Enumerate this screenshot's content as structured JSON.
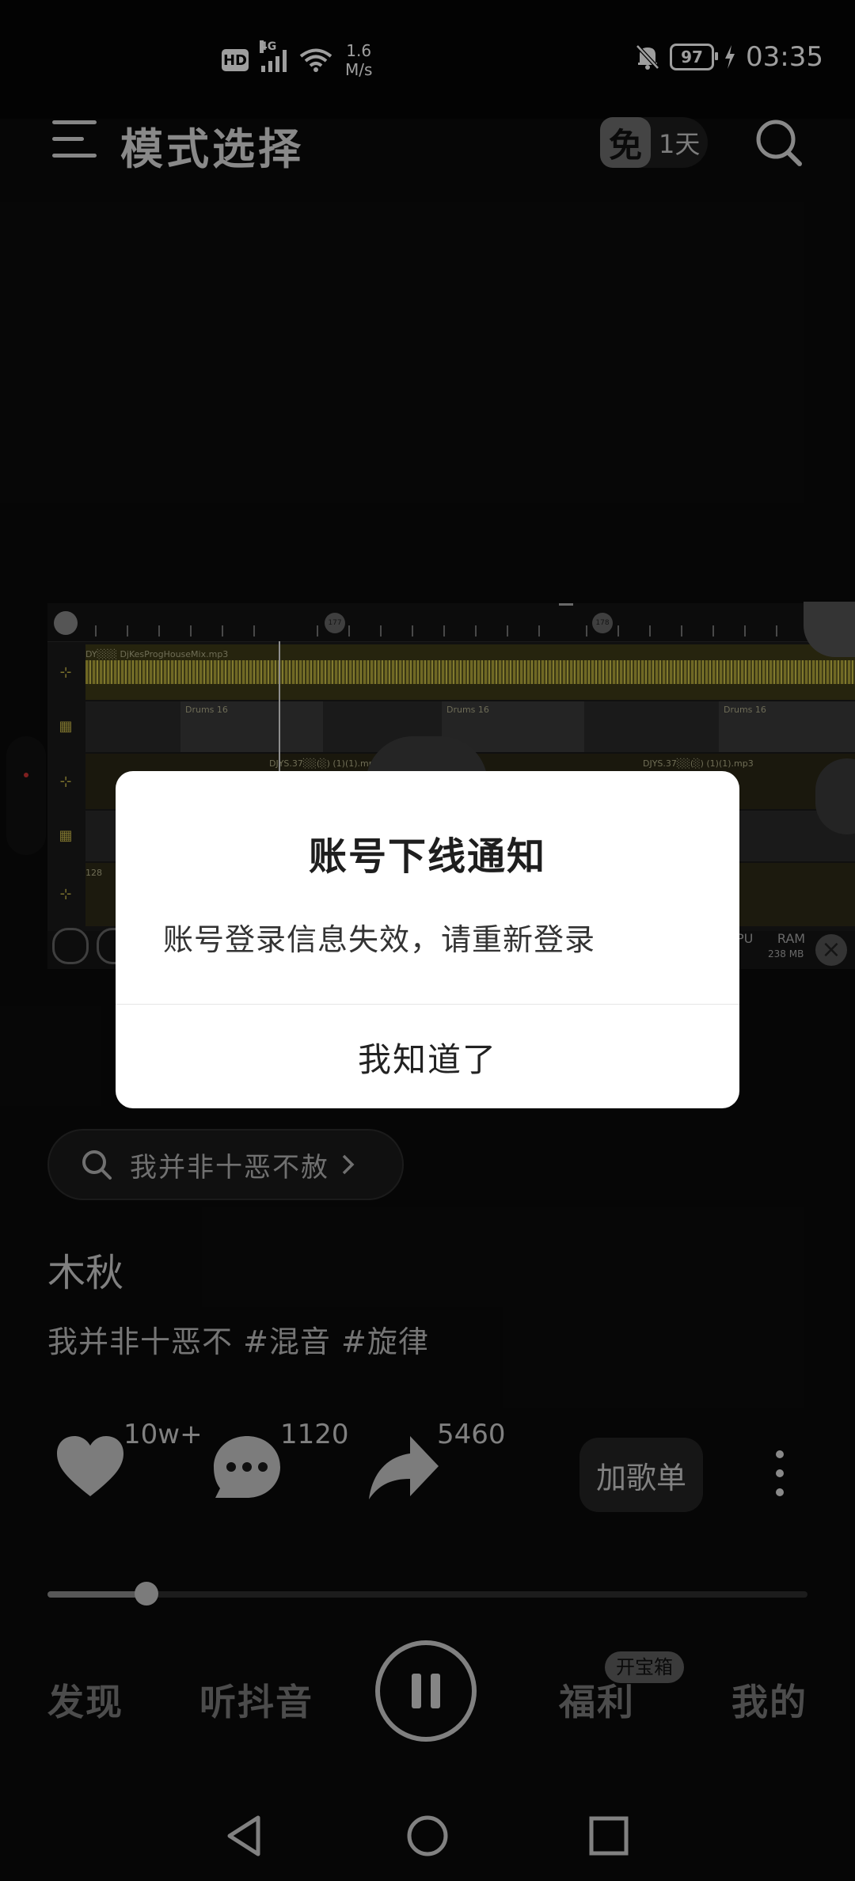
{
  "status_bar": {
    "hd": "HD",
    "network": "4G",
    "speed_value": "1.6",
    "speed_unit": "M/s",
    "battery": "97",
    "time": "03:35"
  },
  "header": {
    "title": "模式选择",
    "free_badge_icon": "免",
    "free_badge_days": "1天"
  },
  "dj_editor": {
    "track1_file": "DY░░░ DjKesProgHouseMix.mp3",
    "pattern_label": "Drums 16",
    "track3_file_a": "DJYS.37░░(░) (1)(1).mp3",
    "track3_file_b": "DJYS.37░░(░) (1)(1).mp3",
    "track5_label": "128",
    "ruler_marker_1": "177",
    "ruler_marker_2": "178",
    "cpu_label": "PU",
    "ram_label": "RAM",
    "ram_value": "238 MB"
  },
  "search_chip": {
    "text": "我并非十恶不赦"
  },
  "song": {
    "author": "木秋",
    "description": "我并非十恶不 #混音 #旋律"
  },
  "actions": {
    "like_count": "10w+",
    "comment_count": "1120",
    "share_count": "5460",
    "add_playlist_label": "加歌单"
  },
  "player": {
    "progress": 0.13
  },
  "bottom_nav": {
    "discover": "发现",
    "listen": "听抖音",
    "welfare": "福利",
    "welfare_badge": "开宝箱",
    "mine": "我的"
  },
  "dialog": {
    "title": "账号下线通知",
    "message": "账号登录信息失效，请重新登录",
    "confirm": "我知道了"
  }
}
